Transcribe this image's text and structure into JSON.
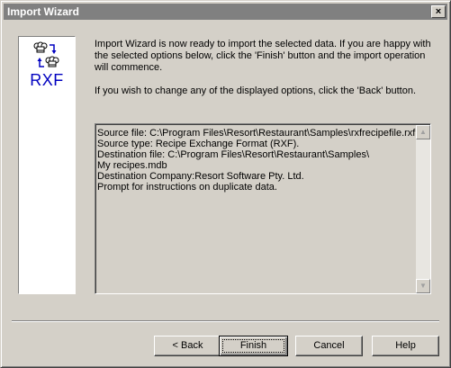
{
  "window": {
    "title": "Import Wizard",
    "close_glyph": "×"
  },
  "logo": {
    "icon": "chef-hats-exchange-icon",
    "text": "RXF"
  },
  "intro": {
    "paragraph1": "Import Wizard is now ready to import the selected data.  If you are happy with the selected options below, click the 'Finish' button and the import operation will commence.",
    "paragraph2": "If you wish to change any of the displayed options, click the 'Back' button."
  },
  "details": {
    "lines": [
      "Source file: C:\\Program Files\\Resort\\Restaurant\\Samples\\rxfrecipefile.rxf",
      "Source type: Recipe Exchange Format (RXF).",
      "Destination file: C:\\Program Files\\Resort\\Restaurant\\Samples\\",
      "My recipes.mdb",
      "Destination Company:Resort Software Pty. Ltd.",
      "Prompt for instructions on duplicate data."
    ]
  },
  "buttons": {
    "back": "< Back",
    "finish": "Finish",
    "cancel": "Cancel",
    "help": "Help"
  }
}
